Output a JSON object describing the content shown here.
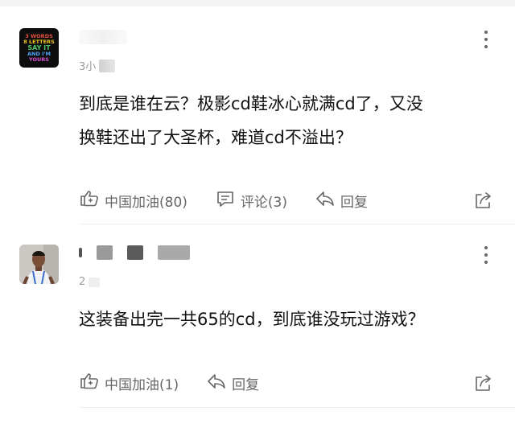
{
  "comments": [
    {
      "avatar_lines": [
        "3 WORDS",
        "8 LETTERS",
        "SAY IT",
        "AND I'M",
        "YOURS"
      ],
      "timestamp": "3小",
      "text_line1": "到底是谁在云？极影cd鞋冰心就满cd了，又没",
      "text_line2": "换鞋还出了大圣杯，难道cd不溢出？",
      "like_label": "中国加油(80)",
      "reply_count_label": "评论(3)",
      "reply_label": "回复"
    },
    {
      "timestamp": "2",
      "text_line1": "这装备出完一共65的cd，到底谁没玩过游戏？",
      "like_label": "中国加油(1)",
      "reply_label": "回复"
    }
  ],
  "colors": {
    "text": "#111111",
    "secondary": "#666666",
    "timestamp": "#9a9a9a",
    "divider": "#eeeeee"
  },
  "icons": [
    "more-vertical-icon",
    "like-thumb-icon",
    "comment-bubble-icon",
    "reply-arrow-icon",
    "share-icon"
  ]
}
